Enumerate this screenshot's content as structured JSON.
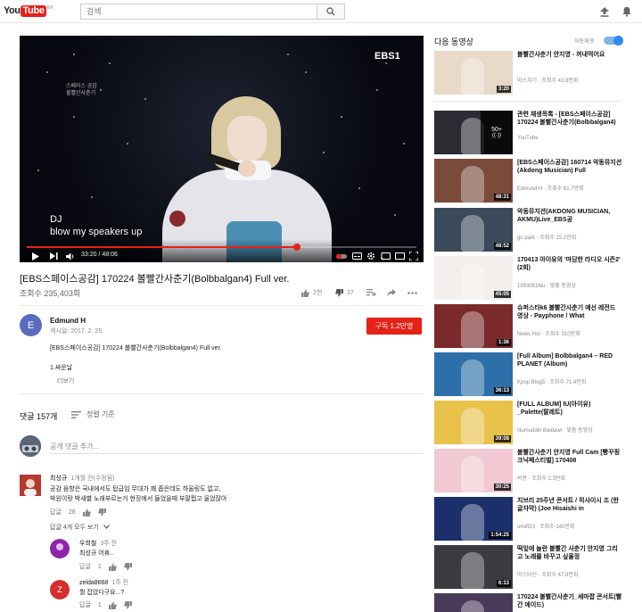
{
  "topbar": {
    "logo_you": "You",
    "logo_tube": "Tube",
    "logo_region": "KR",
    "search_placeholder": "검색"
  },
  "player": {
    "channel_logo": "EBS1",
    "show_title_line1": "스페이스 공감",
    "show_title_line2": "볼빨간사춘기",
    "subtitle_line1": "DJ",
    "subtitle_line2": "blow my speakers up",
    "time": "33:20 / 48:06",
    "progress_fraction": 0.693,
    "accent_color": "#e62117"
  },
  "video": {
    "title": "[EBS스페이스공감] 170224 볼빨간사춘기(Bolbbalgan4) Full ver.",
    "views": "조회수 235,403회",
    "likes": "2천",
    "dislikes": "37"
  },
  "channel": {
    "avatar_letter": "E",
    "name": "Edmund H",
    "date": "게시일: 2017. 2. 25.",
    "subscribe_label": "구독 1.2만명",
    "description_line1": "[EBS스페이스공감] 170224 볼빨간사춘기(Bolbbalgan4) Full ver.",
    "description_line2": "1.싸운날",
    "more_label": "더보기"
  },
  "comments": {
    "count_label": "댓글 157개",
    "sort_label": "정렬 기준",
    "add_placeholder": "공개 댓글 추가...",
    "items": [
      {
        "author": "최성규",
        "time": "1개월 전(수정됨)",
        "text_line1": "공감 음향은 국내에서도 탑급임 무대가 꽤 좁은데도 하울링도 없고,",
        "text_line2": "박원이랑 박새별 노래부르는거 현장에서 들었을때 부팔찝고 울었잖아",
        "reply_label": "답글",
        "likes": "26",
        "avatar_letter": "",
        "avatar_color": "#c0392b"
      }
    ],
    "replies_toggle": "답글 4개 모두 보기",
    "replies": [
      {
        "author": "우희철",
        "time": "3주 전",
        "text": "최성규 어휴..",
        "reply_label": "답글",
        "likes": "1",
        "avatar_letter": "",
        "avatar_color": "#8e24aa"
      },
      {
        "author": "zelda8668",
        "time": "1주 전",
        "text": "뭘 잡았다구요...?",
        "reply_label": "답글",
        "likes": "1",
        "avatar_letter": "Z",
        "avatar_color": "#d32f2f"
      }
    ]
  },
  "sidebar": {
    "up_next": "다음 동영상",
    "autoplay_label": "자동재생",
    "items": [
      {
        "title": "볼빨간사춘기 안지영 - 꺼내먹어요",
        "channel": "미스치기",
        "views": "조회수 43.8만회",
        "duration": "3:20",
        "thumb": "#e9d9c8"
      },
      {
        "title": "관련 재생목록 - [EBS스페이스공감] 170224 볼빨간사춘기(Bolbbalgan4)",
        "channel": "YouTube",
        "views": "",
        "duration": "",
        "playlist_count": "50+",
        "thumb": "#2b2b33"
      },
      {
        "title": "[EBS스페이스공감] 160714 악동뮤지션 (Akdong Musician) Full",
        "channel": "Edmund H",
        "views": "조회수 61.7만회",
        "duration": "48:31",
        "thumb": "#7a4a3a"
      },
      {
        "title": "악동뮤지션(AKDONG MUSICIAN, AKMU)Live_EBS공",
        "channel": "go park",
        "views": "조회수 15.2만회",
        "duration": "48:52",
        "thumb": "#3a4a5a"
      },
      {
        "title": "170413 아이유의 '마담한 라디오 시즌2' (2회)",
        "channel": "19930516iu",
        "views": "맞춤 동영상",
        "duration": "45:05",
        "thumb": "#f3efec"
      },
      {
        "title": "슈퍼스타k6 볼빨간사춘기 예선 레전드 영상 - Payphone / What",
        "channel": "News Hot",
        "views": "조회수 310만회",
        "duration": "1:36",
        "thumb": "#7a2a2a"
      },
      {
        "title": "[Full Album] Bolbbalgan4 – RED PLANET (Album)",
        "channel": "Kpop Blog5",
        "views": "조회수 71.4만회",
        "duration": "36:13",
        "thumb": "#2d6fa8"
      },
      {
        "title": "[FULL ALBUM] IU(아이유) _Palette(팔레트)",
        "channel": "Numuddin Baidawi",
        "views": "맞춤 동영상",
        "duration": "39:08",
        "thumb": "#e8c24a"
      },
      {
        "title": "볼빨간사춘기 안지영 Full Cam [빵꾸핑크닉페스티벌] 170408",
        "channel": "비몽",
        "views": "조회수 2.3만회",
        "duration": "30:25",
        "thumb": "#f2c8d2"
      },
      {
        "title": "지브리 25주년 콘서트 / 히사이시 조 (한글자막) (Joe Hisaishi in",
        "channel": "onoff23",
        "views": "조회수 140만회",
        "duration": "1:54:25",
        "thumb": "#1b2f6a"
      },
      {
        "title": "떡잎에 놀란 볼빨간 사춘기 안지영 그리고 노래를 바꾸고 싶울정",
        "channel": "미스터신",
        "views": "조회수 47.8만회",
        "duration": "6:13",
        "thumb": "#3a3a40"
      },
      {
        "title": "170224 볼빨간사춘기_세마팝 콘서트(빨간 에이드)",
        "channel": "",
        "views": "",
        "duration": "",
        "thumb": "#4a3a5a"
      }
    ]
  }
}
